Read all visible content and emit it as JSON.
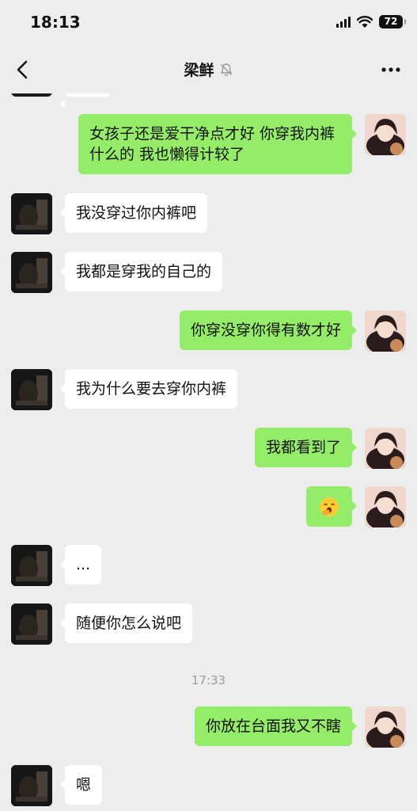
{
  "status_bar": {
    "time": "18:13",
    "battery": "72",
    "icons": [
      "signal-icon",
      "wifi-icon",
      "battery-icon"
    ]
  },
  "nav": {
    "title": "梁鲜",
    "icons": [
      "back-icon",
      "mute-bell-icon",
      "more-icon"
    ]
  },
  "colors": {
    "background": "#ededed",
    "sent_bubble": "#95ec69",
    "received_bubble": "#ffffff",
    "timestamp": "#9b9b9b"
  },
  "messages": [
    {
      "side": "right",
      "text": "女孩子还是爱干净点才好 你穿我内裤什么的 我也懒得计较了"
    },
    {
      "side": "left",
      "text": "我没穿过你内裤吧"
    },
    {
      "side": "left",
      "text": "我都是穿我的自己的"
    },
    {
      "side": "right",
      "text": "你穿没穿你得有数才好"
    },
    {
      "side": "left",
      "text": "我为什么要去穿你内裤"
    },
    {
      "side": "right",
      "text": "我都看到了"
    },
    {
      "side": "right",
      "emoji": "yawn-face-icon"
    },
    {
      "side": "left",
      "text": "..."
    },
    {
      "side": "left",
      "text": "随便你怎么说吧"
    },
    {
      "time": "17:33"
    },
    {
      "side": "right",
      "text": "你放在台面我又不瞎"
    },
    {
      "side": "left",
      "text": "嗯"
    }
  ]
}
